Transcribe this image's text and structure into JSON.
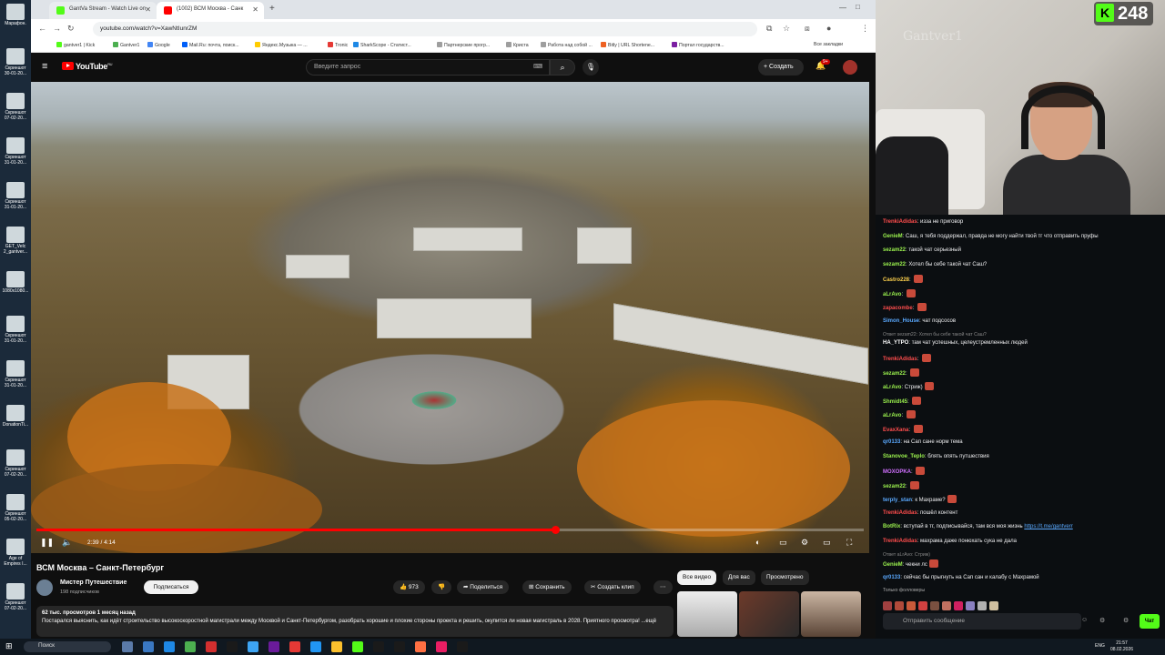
{
  "desktop": {
    "icons": [
      "Марафон.",
      "Скриншот 30-01-20...",
      "Скриншот 07-02-20...",
      "Скриншот 31-01-20...",
      "Скриншот 31-01-20...",
      "GET_Velc 2_gantver...",
      "1080x1080...",
      "Скриншот 31-01-20...",
      "Скриншот 31-01-20...",
      "DonationTi...",
      "Скриншот 07-02-20...",
      "Скриншот 05-02-20...",
      "Age of Empires I...",
      "Скриншот 07-02-20..."
    ]
  },
  "browser": {
    "tabs": [
      {
        "title": "GantVa Stream - Watch Live on",
        "fav_color": "#53fc18"
      },
      {
        "title": "(1002) ВСМ Москва - Санк",
        "fav_color": "#ff0000"
      }
    ],
    "url": "youtube.com/watch?v=XawNtIunrZM",
    "bookmarks": [
      {
        "label": "gantver1 | Kick",
        "color": "#53fc18"
      },
      {
        "label": "Gantver1",
        "color": "#4caf50"
      },
      {
        "label": "Google",
        "color": "#4285f4"
      },
      {
        "label": "Mail.Ru: почта, поиск...",
        "color": "#005ff9"
      },
      {
        "label": "Яндекс.Музыка — ...",
        "color": "#ffcc00"
      },
      {
        "label": "Tronic",
        "color": "#e53935"
      },
      {
        "label": "SharkScope - Статист...",
        "color": "#1e88e5"
      },
      {
        "label": "Партнерские прогр...",
        "color": "#9e9e9e"
      },
      {
        "label": "Криста",
        "color": "#9e9e9e"
      },
      {
        "label": "Работа над собой ...",
        "color": "#9e9e9e"
      },
      {
        "label": "Bitly | URL Shortene...",
        "color": "#ee6123"
      },
      {
        "label": "Портал государств...",
        "color": "#7b1fa2"
      }
    ],
    "all_bookmarks_label": "Все закладки"
  },
  "youtube": {
    "logo_text": "YouTube",
    "logo_region": "RU",
    "search_placeholder": "Введите запрос",
    "create_label": "Создать",
    "notif_count": "9+",
    "video": {
      "time_current": "2:39",
      "time_total": "4:14",
      "time_label": "2:39 / 4:14",
      "progress": 0.627
    },
    "title": "ВСМ Москва – Санкт-Петербург",
    "channel": {
      "name": "Мистер Путешествие",
      "subs": "198 подписчиков"
    },
    "subscribe_label": "Подписаться",
    "likes": "973",
    "share_label": "Поделиться",
    "save_label": "Сохранить",
    "clip_label": "Создать клип",
    "description": {
      "meta": "62 тыс. просмотров  1 месяц назад",
      "text": "Постарался выяснить, как идёт строительство высокоскоростной магистрали между Москвой и Санкт-Петербургом, разобрать хорошие и плохие стороны проекта и решить, окупится ли новая магистраль в 2028. Приятного просмотра! ...ещё"
    },
    "rec_tabs": [
      "Все видео",
      "Для вас",
      "Просмотрено"
    ]
  },
  "stream": {
    "viewer_count": "248",
    "cam_watermark": "Gantver1",
    "chat": [
      {
        "user": "TrenkiAdidas",
        "color": "#ff4d4d",
        "text": "изза не приговор"
      },
      {
        "user": "GenieM",
        "color": "#9bf24e",
        "text": "Саш, я тебя поддержал, правда не могу найти твой тг что отправить пруфы"
      },
      {
        "user": "sezam22",
        "color": "#9bf24e",
        "text": "такой чат серьезный"
      },
      {
        "user": "sezam22",
        "color": "#9bf24e",
        "text": "Хотел бы себе такой чат Саш?"
      },
      {
        "user": "Castro228",
        "color": "#ffd24d",
        "text": ""
      },
      {
        "user": "aLrAvo",
        "color": "#9bf24e",
        "text": ""
      },
      {
        "user": "zapacombe",
        "color": "#ff4d4d",
        "text": ""
      },
      {
        "user": "Simon_House",
        "color": "#5aa9ff",
        "text": "чат подсосов"
      },
      {
        "user": "HA_YTPO",
        "color": "#ffffff",
        "text": "там чат успешных, целеустремленных людей",
        "reply": "Ответ sezam22: Хотел бы себе такой чат Саш?"
      },
      {
        "user": "TrenkiAdidas",
        "color": "#ff4d4d",
        "text": ""
      },
      {
        "user": "sezam22",
        "color": "#9bf24e",
        "text": ""
      },
      {
        "user": "aLrAvo",
        "color": "#9bf24e",
        "text": "Стриж)"
      },
      {
        "user": "Shmidt45",
        "color": "#9bf24e",
        "text": ""
      },
      {
        "user": "aLrAvo",
        "color": "#9bf24e",
        "text": ""
      },
      {
        "user": "EvaxXana",
        "color": "#ff4d4d",
        "text": ""
      },
      {
        "user": "qr0133",
        "color": "#5aa9ff",
        "text": "на Сап сане норм тема"
      },
      {
        "user": "Stanovoe_Teplo",
        "color": "#9bf24e",
        "text": "блять опять путшествия"
      },
      {
        "user": "MOXOPKA",
        "color": "#d070ff",
        "text": ""
      },
      {
        "user": "sezam22",
        "color": "#9bf24e",
        "text": ""
      },
      {
        "user": "terply_stan",
        "color": "#5aa9ff",
        "text": "к Махраме?"
      },
      {
        "user": "TrenkiAdidas",
        "color": "#ff4d4d",
        "text": "пошёл контент"
      },
      {
        "user": "BotRix",
        "color": "#9bf24e",
        "text": "вступай в тг, подписывайся, там вся моя жизнь",
        "link": "https://t.me/gantverr"
      },
      {
        "user": "TrenkiAdidas",
        "color": "#ff4d4d",
        "text": "махрама даже понюхать сука не дала"
      },
      {
        "user": "GenieM",
        "color": "#9bf24e",
        "text": "чекни лс",
        "reply": "Ответ aLrAvo: Стриж)"
      },
      {
        "user": "qr0133",
        "color": "#5aa9ff",
        "text": "сейчас бы прыгнуть на Сап сан и калабу с Махрамой"
      }
    ],
    "followers_note": "Только фолловеры",
    "chat_placeholder": "Отправить сообщение",
    "send_label": "Чат"
  },
  "taskbar": {
    "search_label": "Поиск",
    "lang": "ENG",
    "time": "21:57",
    "date": "08.02.2026"
  }
}
